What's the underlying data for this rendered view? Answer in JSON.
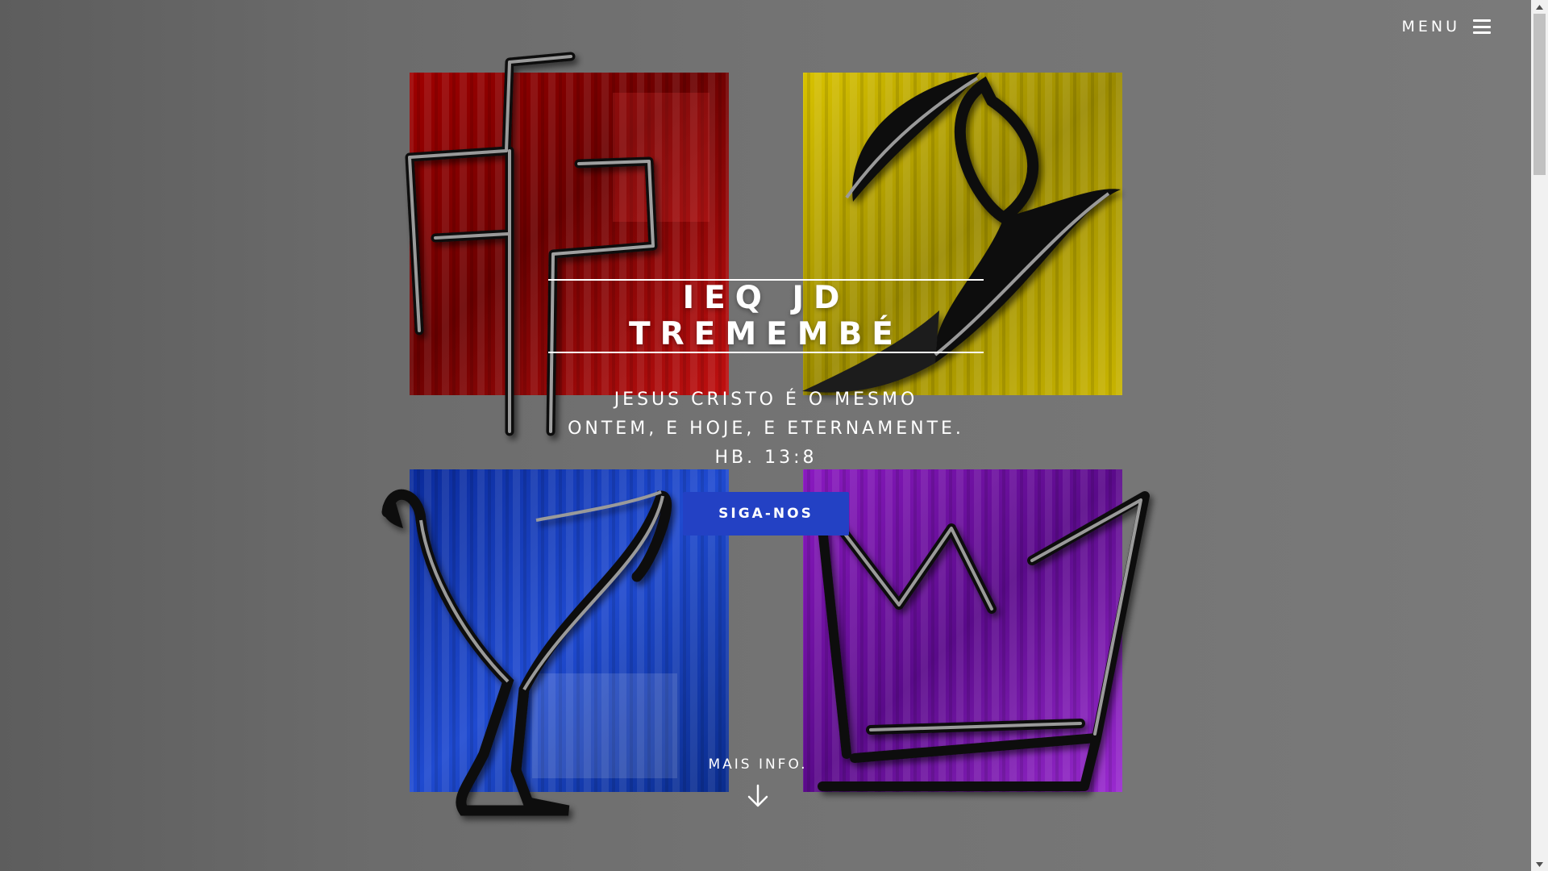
{
  "nav": {
    "menu_label": "MENU"
  },
  "hero": {
    "title": "IEQ JD TREMEMBÉ",
    "verse_lines": [
      "JESUS CRISTO É O MESMO",
      "ONTEM, E HOJE, E ETERNAMENTE.",
      "HB. 13:8"
    ],
    "cta_label": "SIGA-NOS"
  },
  "footer": {
    "more_label": "MAIS INFO."
  },
  "icons": {
    "menu": "hamburger-icon",
    "more": "arrow-down-icon",
    "symbols": [
      "cross-icon",
      "dove-icon",
      "chalice-icon",
      "crown-icon"
    ]
  },
  "colors": {
    "accent_button": "#2341c4",
    "panel_red": "#b50a0a",
    "panel_yellow": "#c4b000",
    "panel_blue": "#1f3fb8",
    "panel_purple": "#7a1ab0"
  }
}
